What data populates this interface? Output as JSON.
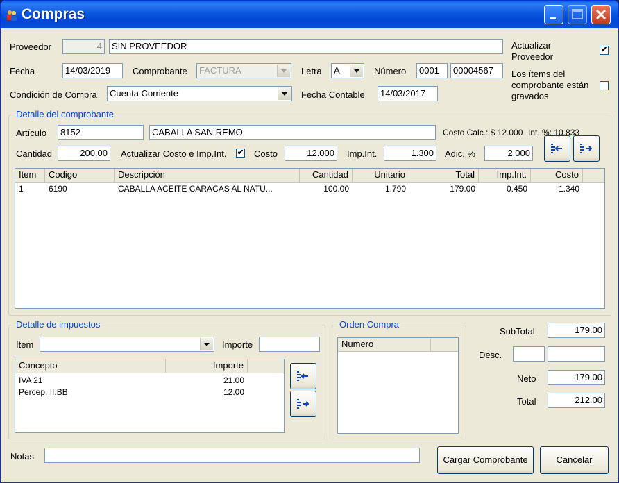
{
  "window": {
    "title": "Compras",
    "app_icon": "users-icon"
  },
  "header": {
    "proveedor_label": "Proveedor",
    "proveedor_code": "4",
    "proveedor_name": "SIN PROVEEDOR",
    "fecha_label": "Fecha",
    "fecha_value": "14/03/2019",
    "comprobante_label": "Comprobante",
    "comprobante_value": "FACTURA",
    "letra_label": "Letra",
    "letra_value": "A",
    "numero_label": "Número",
    "numero_pv": "0001",
    "numero_nro": "00004567",
    "condicion_label": "Condición de Compra",
    "condicion_value": "Cuenta Corriente",
    "fecha_contable_label": "Fecha Contable",
    "fecha_contable_value": "14/03/2017",
    "actualizar_proveedor_line1": "Actualizar",
    "actualizar_proveedor_line2": "Proveedor",
    "actualizar_proveedor_checked": "✔",
    "gravados_line1": "Los ítems del",
    "gravados_line2": "comprobante están",
    "gravados_line3": "gravados",
    "gravados_checked": ""
  },
  "detalle": {
    "group_title": "Detalle del comprobante",
    "articulo_label": "Artículo",
    "articulo_code": "8152",
    "articulo_desc": "CABALLA SAN REMO",
    "costo_calc": "Costo Calc.: $ 12.000",
    "int_pct": "Int. %: 10.833",
    "cantidad_label": "Cantidad",
    "cantidad_value": "200.00",
    "actualizar_costo_label": "Actualizar Costo e Imp.Int.",
    "actualizar_costo_checked": "✔",
    "costo_label": "Costo",
    "costo_value": "12.000",
    "impint_label": "Imp.Int.",
    "impint_value": "1.300",
    "adic_label": "Adic. %",
    "adic_value": "2.000",
    "columns": [
      "Item",
      "Codigo",
      "Descripción",
      "Cantidad",
      "Unitario",
      "Total",
      "Imp.Int.",
      "Costo"
    ],
    "rows": [
      {
        "item": "1",
        "codigo": "6190",
        "descripcion": "CABALLA ACEITE CARACAS AL NATU...",
        "cantidad": "100.00",
        "unitario": "1.790",
        "total": "179.00",
        "impint": "0.450",
        "costo": "1.340"
      }
    ]
  },
  "impuestos": {
    "group_title": "Detalle de impuestos",
    "item_label": "Item",
    "item_value": "",
    "importe_label": "Importe",
    "importe_value": "",
    "columns": [
      "Concepto",
      "Importe"
    ],
    "rows": [
      {
        "concepto": "IVA 21",
        "importe": "21.00"
      },
      {
        "concepto": "Percep. II.BB",
        "importe": "12.00"
      }
    ]
  },
  "orden": {
    "group_title": "Orden Compra",
    "columns": [
      "Numero"
    ]
  },
  "totales": {
    "subtotal_label": "SubTotal",
    "subtotal_value": "179.00",
    "desc_label": "Desc.",
    "desc_pct": "",
    "desc_value": "",
    "neto_label": "Neto",
    "neto_value": "179.00",
    "total_label": "Total",
    "total_value": "212.00"
  },
  "footer": {
    "notas_label": "Notas",
    "notas_value": "",
    "cargar_label": "Cargar Comprobante",
    "cancelar_label": "Cancelar"
  }
}
